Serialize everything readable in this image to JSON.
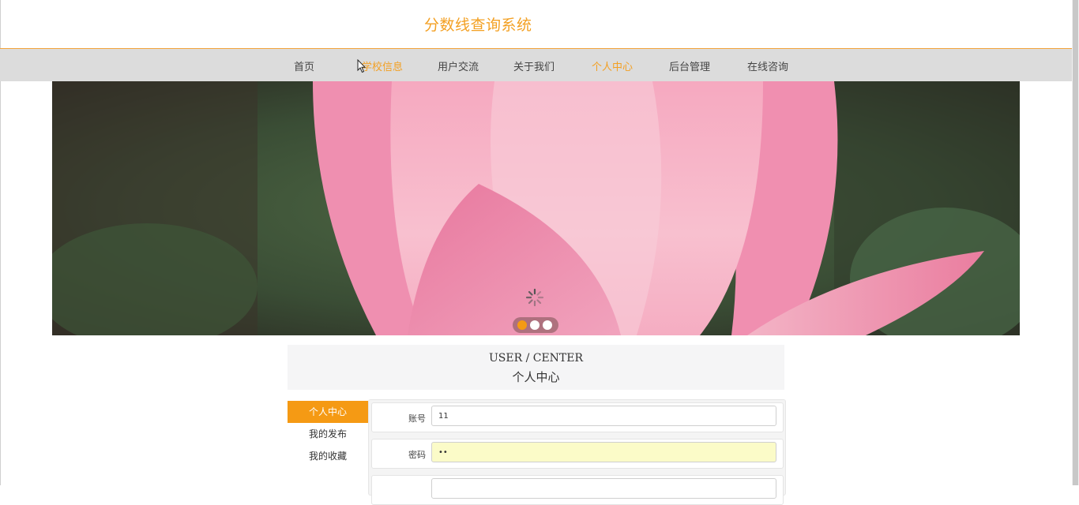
{
  "site": {
    "title": "分数线查询系统"
  },
  "nav": {
    "items": [
      {
        "label": "首页"
      },
      {
        "label": "学校信息"
      },
      {
        "label": "用户交流"
      },
      {
        "label": "关于我们"
      },
      {
        "label": "个人中心",
        "active": true
      },
      {
        "label": "后台管理"
      },
      {
        "label": "在线咨询"
      }
    ]
  },
  "banner": {
    "image": "pink-lotus-flower",
    "slides": 3,
    "active_slide": 1,
    "loading": true
  },
  "center": {
    "title_en": "USER / CENTER",
    "title_cn": "个人中心"
  },
  "side_menu": {
    "items": [
      {
        "label": "个人中心",
        "active": true
      },
      {
        "label": "我的发布"
      },
      {
        "label": "我的收藏"
      }
    ]
  },
  "form": {
    "account_label": "账号",
    "account_value": "11",
    "password_label": "密码",
    "password_value": "11"
  },
  "colors": {
    "accent": "#f3a023",
    "nav_bg": "#dcdcdc",
    "active_dot": "#f59a14",
    "autofill_bg": "#fbfbc8"
  }
}
